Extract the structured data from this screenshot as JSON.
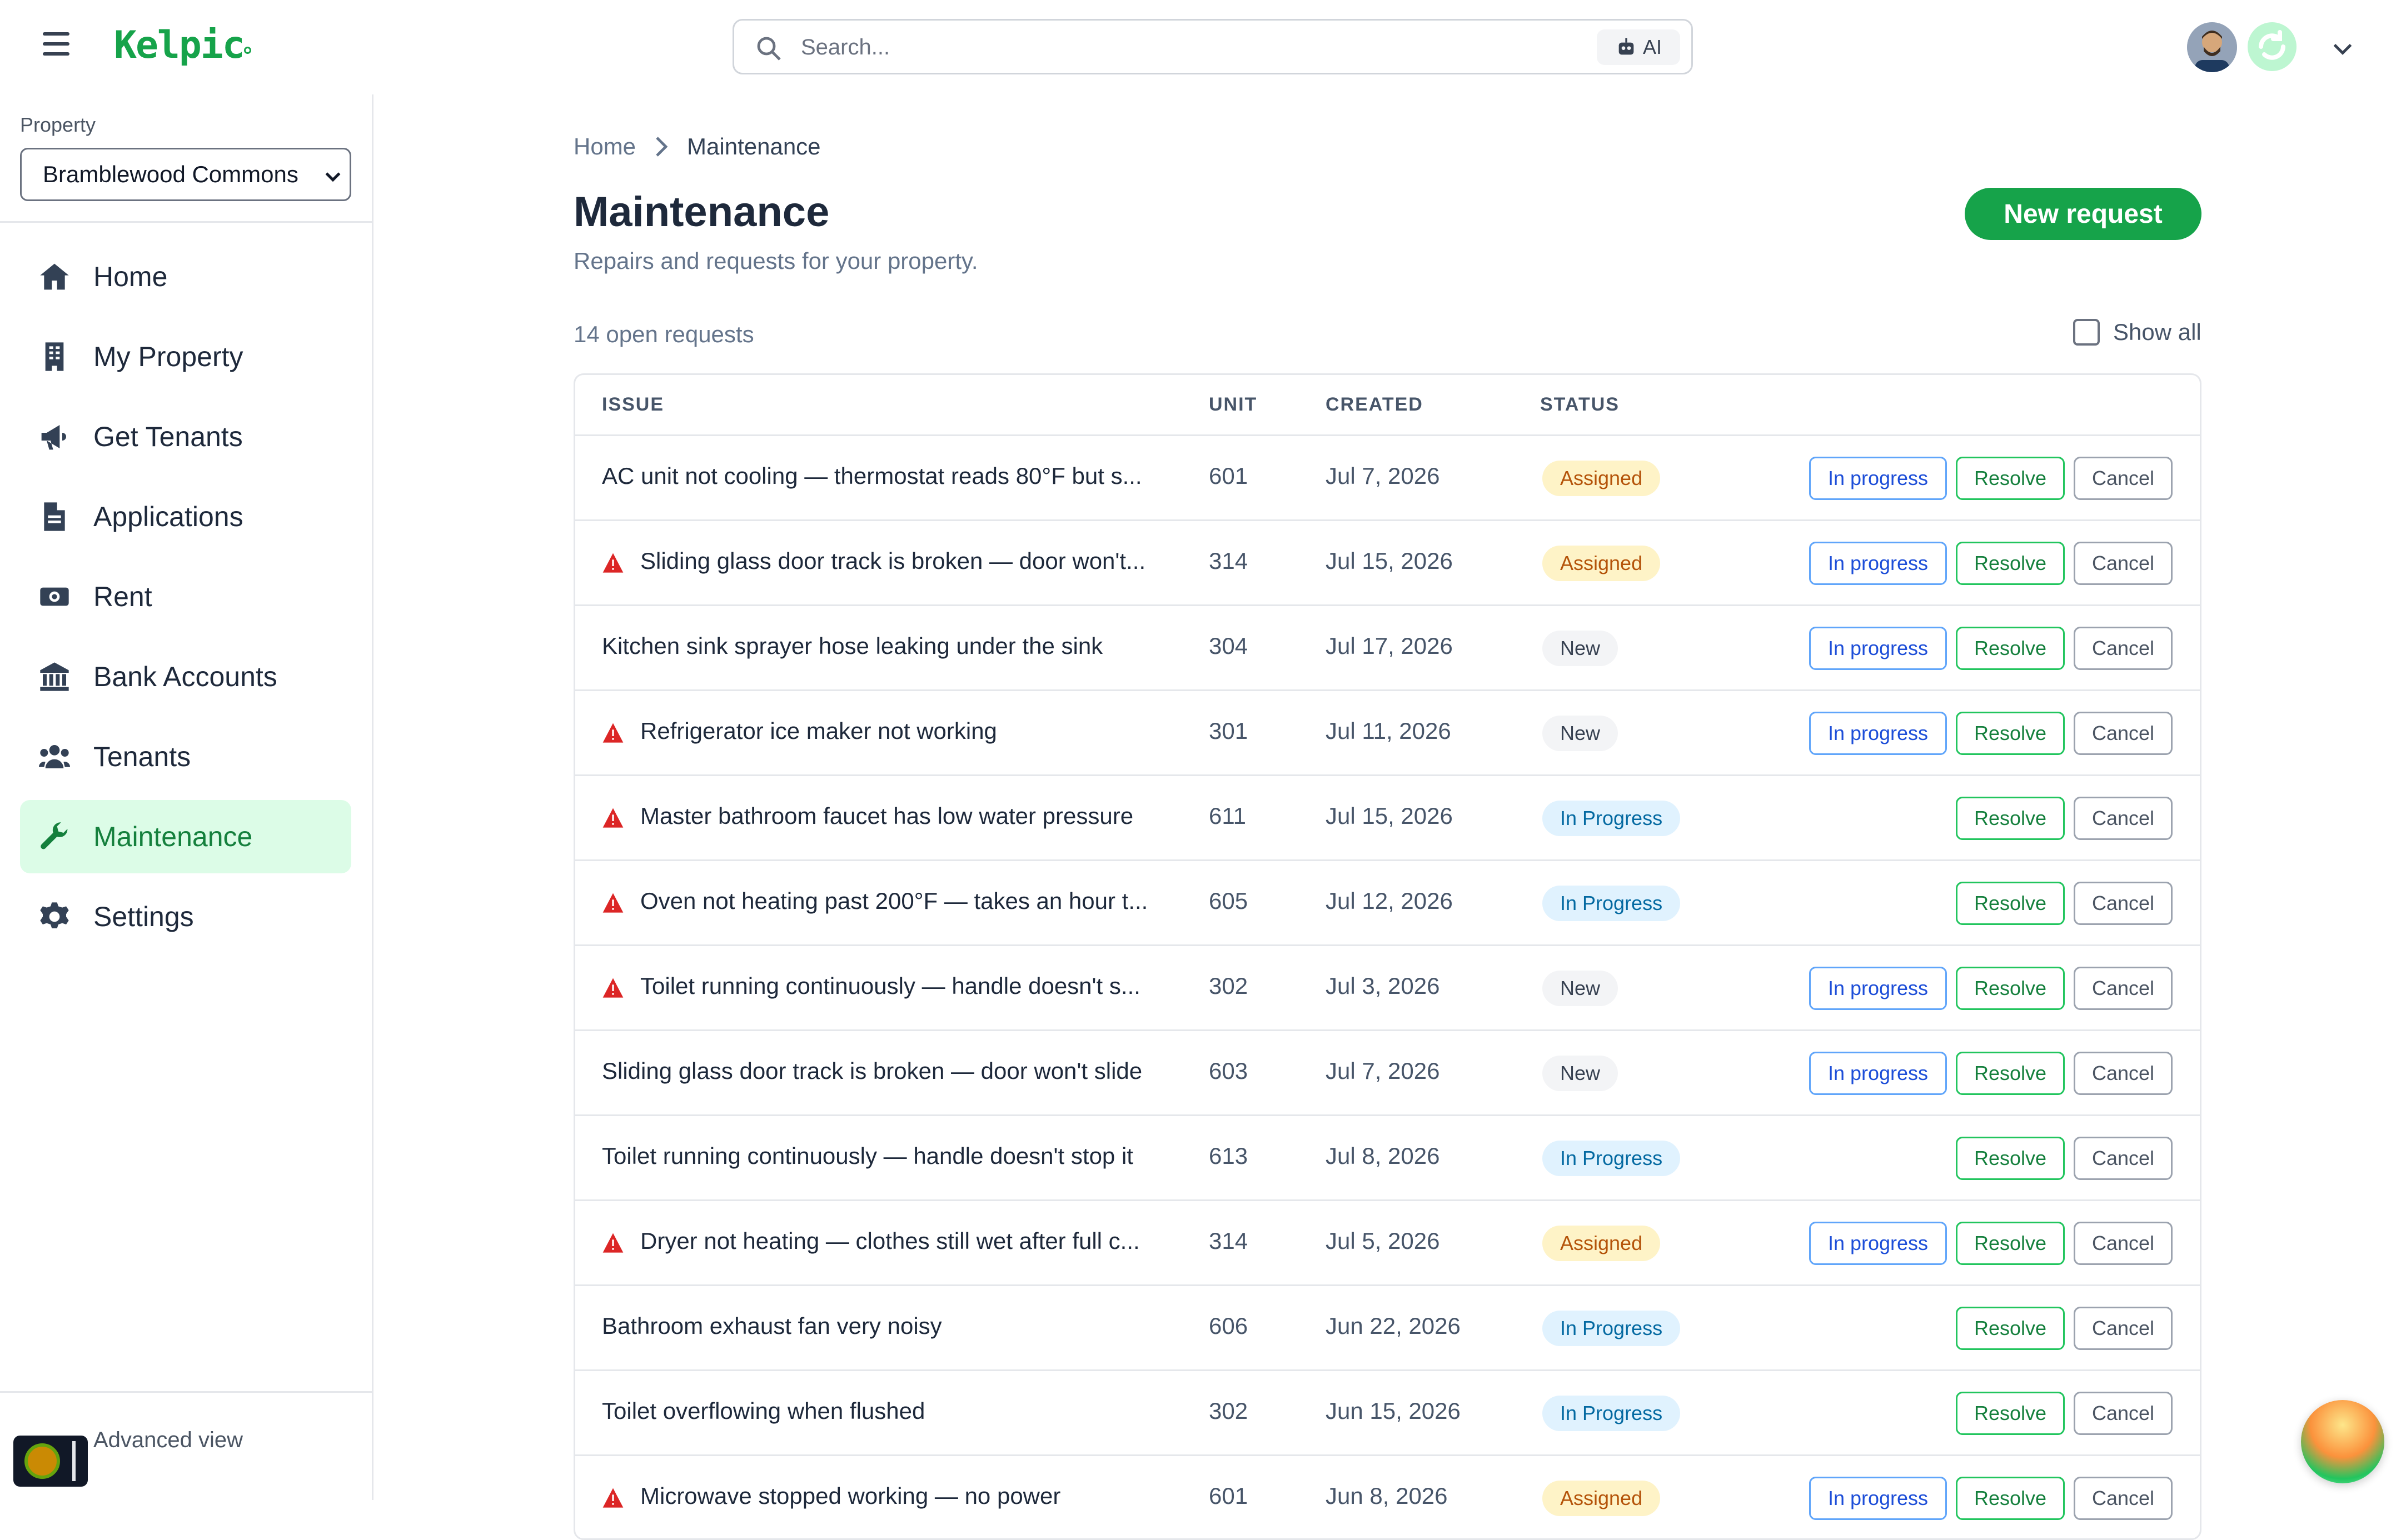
{
  "app": {
    "name": "Kelpic"
  },
  "search": {
    "placeholder": "Search...",
    "ai_label": "AI"
  },
  "sidebar": {
    "property_label": "Property",
    "property_value": "Bramblewood Commons",
    "items": [
      {
        "label": "Home",
        "icon": "home-icon",
        "active": false
      },
      {
        "label": "My Property",
        "icon": "building-icon",
        "active": false
      },
      {
        "label": "Get Tenants",
        "icon": "megaphone-icon",
        "active": false
      },
      {
        "label": "Applications",
        "icon": "document-icon",
        "active": false
      },
      {
        "label": "Rent",
        "icon": "money-icon",
        "active": false
      },
      {
        "label": "Bank Accounts",
        "icon": "bank-icon",
        "active": false
      },
      {
        "label": "Tenants",
        "icon": "users-icon",
        "active": false
      },
      {
        "label": "Maintenance",
        "icon": "wrench-icon",
        "active": true
      },
      {
        "label": "Settings",
        "icon": "gear-icon",
        "active": false
      }
    ],
    "advanced_view": "Advanced view"
  },
  "breadcrumb": {
    "home": "Home",
    "current": "Maintenance"
  },
  "page": {
    "title": "Maintenance",
    "subtitle": "Repairs and requests for your property.",
    "new_button": "New request",
    "count": "14 open requests",
    "show_all": "Show all"
  },
  "table": {
    "headers": {
      "issue": "ISSUE",
      "unit": "UNIT",
      "created": "CREATED",
      "status": "STATUS"
    },
    "actions": {
      "in_progress": "In progress",
      "resolve": "Resolve",
      "cancel": "Cancel"
    },
    "rows": [
      {
        "issue": "AC unit not cooling — thermostat reads 80°F but s...",
        "urgent": false,
        "unit": "601",
        "created": "Jul 7, 2026",
        "status": "Assigned"
      },
      {
        "issue": "Sliding glass door track is broken — door won't...",
        "urgent": true,
        "unit": "314",
        "created": "Jul 15, 2026",
        "status": "Assigned"
      },
      {
        "issue": "Kitchen sink sprayer hose leaking under the sink",
        "urgent": false,
        "unit": "304",
        "created": "Jul 17, 2026",
        "status": "New"
      },
      {
        "issue": "Refrigerator ice maker not working",
        "urgent": true,
        "unit": "301",
        "created": "Jul 11, 2026",
        "status": "New"
      },
      {
        "issue": "Master bathroom faucet has low water pressure",
        "urgent": true,
        "unit": "611",
        "created": "Jul 15, 2026",
        "status": "In Progress"
      },
      {
        "issue": "Oven not heating past 200°F — takes an hour t...",
        "urgent": true,
        "unit": "605",
        "created": "Jul 12, 2026",
        "status": "In Progress"
      },
      {
        "issue": "Toilet running continuously — handle doesn't s...",
        "urgent": true,
        "unit": "302",
        "created": "Jul 3, 2026",
        "status": "New"
      },
      {
        "issue": "Sliding glass door track is broken — door won't slide",
        "urgent": false,
        "unit": "603",
        "created": "Jul 7, 2026",
        "status": "New"
      },
      {
        "issue": "Toilet running continuously — handle doesn't stop it",
        "urgent": false,
        "unit": "613",
        "created": "Jul 8, 2026",
        "status": "In Progress"
      },
      {
        "issue": "Dryer not heating — clothes still wet after full c...",
        "urgent": true,
        "unit": "314",
        "created": "Jul 5, 2026",
        "status": "Assigned"
      },
      {
        "issue": "Bathroom exhaust fan very noisy",
        "urgent": false,
        "unit": "606",
        "created": "Jun 22, 2026",
        "status": "In Progress"
      },
      {
        "issue": "Toilet overflowing when flushed",
        "urgent": false,
        "unit": "302",
        "created": "Jun 15, 2026",
        "status": "In Progress"
      },
      {
        "issue": "Microwave stopped working — no power",
        "urgent": true,
        "unit": "601",
        "created": "Jun 8, 2026",
        "status": "Assigned"
      }
    ]
  },
  "colors": {
    "brand": "#16a34a",
    "active_bg": "#dcfce7",
    "urgent": "#dc2626"
  }
}
